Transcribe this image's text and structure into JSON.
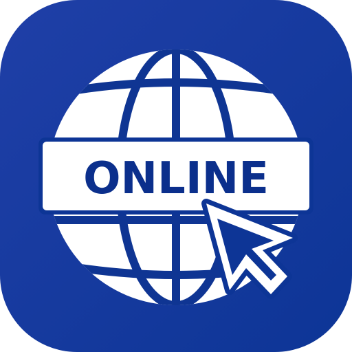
{
  "icon": {
    "name": "online-globe-icon",
    "label": "ONLINE",
    "colors": {
      "background_top_left": "#1f3fa7",
      "background_bottom_right": "#0d3596",
      "foreground": "#ffffff",
      "text": "#0b2f8c"
    }
  }
}
